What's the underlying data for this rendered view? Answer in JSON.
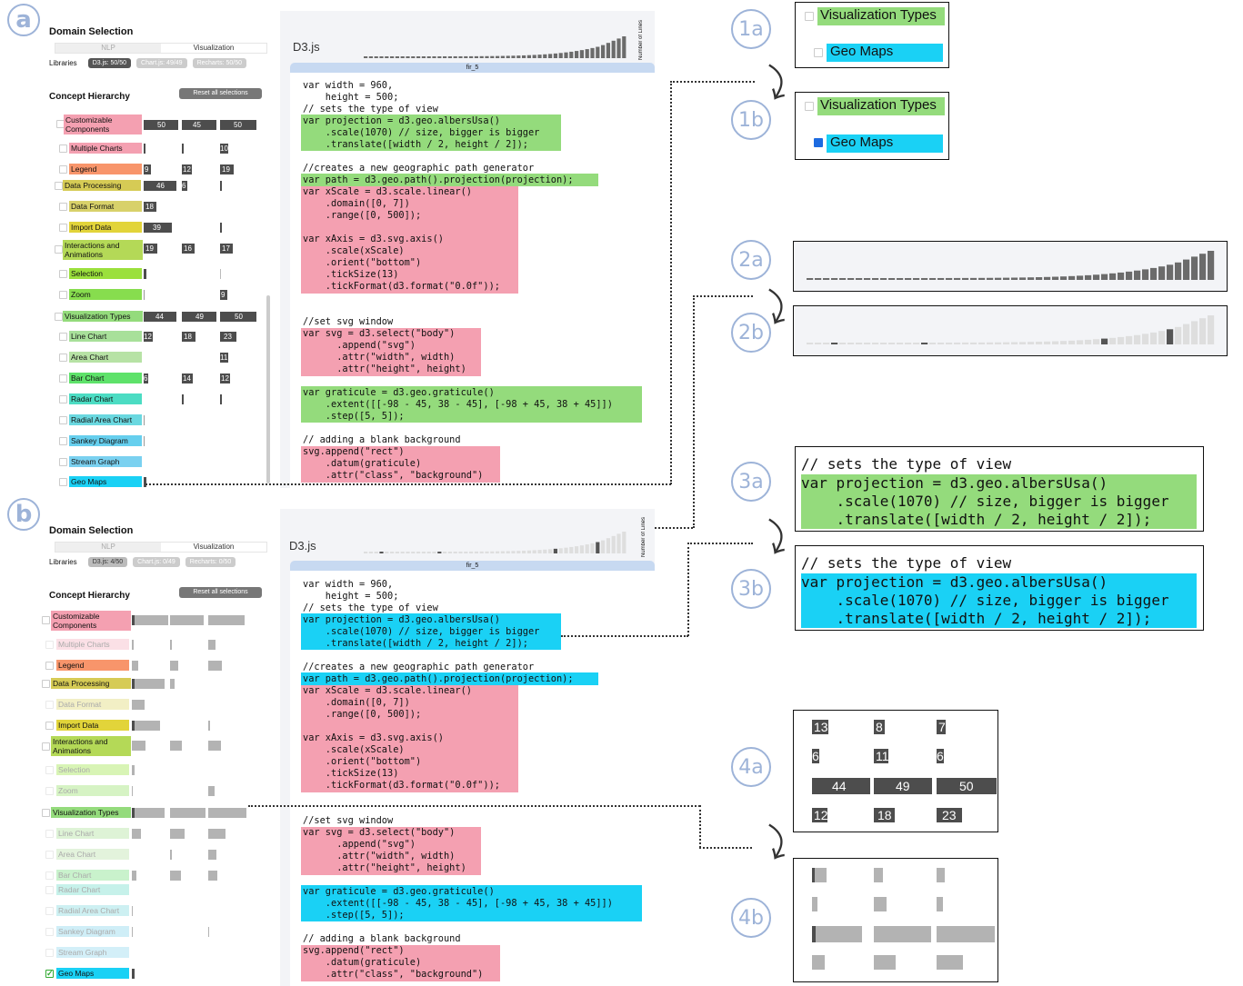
{
  "colors": {
    "green": "#94db7c",
    "pink": "#f4a0b1",
    "cyan": "#1ad1f5",
    "tab": "#c7d9f1"
  },
  "markers": {
    "a": "a",
    "b": "b",
    "c1a": "1a",
    "c1b": "1b",
    "c2a": "2a",
    "c2b": "2b",
    "c3a": "3a",
    "c3b": "3b",
    "c4a": "4a",
    "c4b": "4b"
  },
  "panelA": {
    "domain_title": "Domain Selection",
    "tab_nlp": "NLP",
    "tab_vis": "Visualization",
    "libs_label": "Libraries",
    "lib_d3": "D3.js: 50/50",
    "lib_chart": "Chart.js: 49/49",
    "lib_recharts": "Recharts: 50/50",
    "concept_title": "Concept Hierarchy",
    "reset": "Reset all selections",
    "c0": "Customizable Components",
    "c0a": "50",
    "c0b": "45",
    "c0c": "50",
    "c1": "Multiple Charts",
    "c1c": "10",
    "c2": "Legend",
    "c2a": "9",
    "c2b": "12",
    "c2c": "19",
    "c3": "Data Processing",
    "c3a": "46",
    "c3b": "6",
    "c4": "Data Format",
    "c4a": "18",
    "c5": "Import Data",
    "c5a": "39",
    "c6": "Interactions and Animations",
    "c6a": "19",
    "c6b": "16",
    "c6c": "17",
    "c7": "Selection",
    "c8": "Zoom",
    "c8c": "9",
    "c9": "Visualization Types",
    "c9a": "44",
    "c9b": "49",
    "c9c": "50",
    "c10": "Line Chart",
    "c10a": "12",
    "c10b": "18",
    "c10c": "23",
    "c11": "Area Chart",
    "c11c": "11",
    "c12": "Bar Chart",
    "c12a": "6",
    "c12b": "14",
    "c12c": "12",
    "c13": "Radar Chart",
    "c14": "Radial Area Chart",
    "c15": "Sankey Diagram",
    "c16": "Stream Graph",
    "c17": "Geo Maps",
    "code_title": "D3.js",
    "lines_label": "Number of Lines",
    "file_tab": "fir_5"
  },
  "panelB": {
    "domain_title": "Domain Selection",
    "tab_nlp": "NLP",
    "tab_vis": "Visualization",
    "libs_label": "Libraries",
    "lib_d3": "D3.js: 4/50",
    "lib_chart": "Chart.js: 0/49",
    "lib_recharts": "Recharts: 0/50",
    "concept_title": "Concept Hierarchy",
    "reset": "Reset all selections",
    "c0": "Customizable Components",
    "c1": "Multiple Charts",
    "c2": "Legend",
    "c3": "Data Processing",
    "c4": "Data Format",
    "c5": "Import Data",
    "c6": "Interactions and Animations",
    "c7": "Selection",
    "c8": "Zoom",
    "c9": "Visualization Types",
    "c10": "Line Chart",
    "c11": "Area Chart",
    "c12": "Bar Chart",
    "c13": "Radar Chart",
    "c14": "Radial Area Chart",
    "c15": "Sankey Diagram",
    "c16": "Stream Graph",
    "c17": "Geo Maps",
    "check": "✓",
    "code_title": "D3.js",
    "lines_label": "Number of Lines",
    "file_tab": "fir_5"
  },
  "code": {
    "l1": "var width = 960,\n    height = 500;\n// sets the type of view",
    "l2": "var projection = d3.geo.albersUsa()\n    .scale(1070) // size, bigger is bigger\n    .translate([width / 2, height / 2]);",
    "l3": "//creates a new geographic path generator",
    "l4": "var path = d3.geo.path().projection(projection);",
    "l5": "var xScale = d3.scale.linear()\n    .domain([0, 7])\n    .range([0, 500]);\n\nvar xAxis = d3.svg.axis()\n    .scale(xScale)\n    .orient(\"bottom\")\n    .tickSize(13)\n    .tickFormat(d3.format(\"0.0f\"));",
    "l6": "//set svg window",
    "l7": "var svg = d3.select(\"body\")\n      .append(\"svg\")\n      .attr(\"width\", width)\n      .attr(\"height\", height)",
    "l8": "var graticule = d3.geo.graticule()\n    .extent([[-98 - 45, 38 - 45], [-98 + 45, 38 + 45]])\n    .step([5, 5]);",
    "l9": "// adding a blank background",
    "l10": "svg.append(\"rect\")\n    .datum(graticule)\n    .attr(\"class\", \"background\")"
  },
  "zoom": {
    "vis_types": "Visualization Types",
    "geo_maps": "Geo Maps",
    "code3": "// sets the type of view",
    "code3b": "var projection = d3.geo.albersUsa()\n    .scale(1070) // size, bigger is bigger\n    .translate([width / 2, height / 2]);",
    "n13": "13",
    "n8": "8",
    "n7": "7",
    "n6a": "6",
    "n11": "11",
    "n6b": "6",
    "n44": "44",
    "n49": "49",
    "n50": "50",
    "n12": "12",
    "n18": "18",
    "n23": "23"
  }
}
